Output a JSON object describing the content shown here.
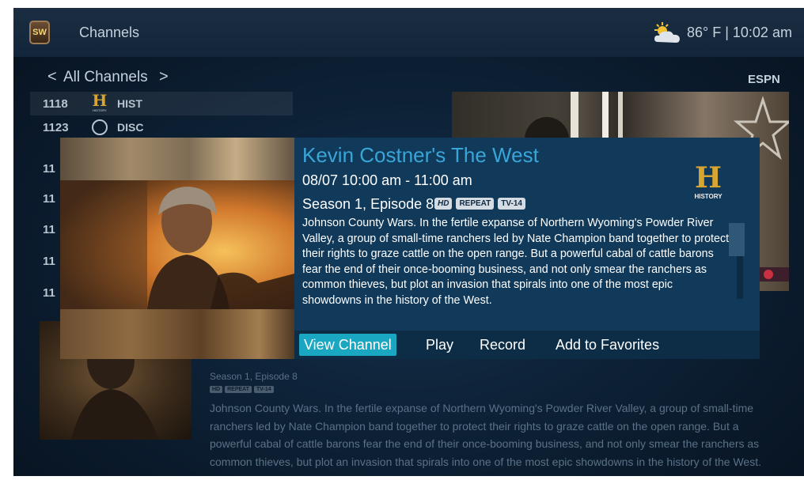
{
  "header": {
    "app_logo_text": "SW",
    "title": "Channels",
    "status": "86° F | 10:02 am"
  },
  "channel_nav": {
    "prev_glyph": "<",
    "label": "All Channels",
    "next_glyph": ">",
    "preview_channel": "ESPN"
  },
  "channels": [
    {
      "number": "1118",
      "name": "HIST",
      "logo": "history-icon",
      "logo_text": "H"
    },
    {
      "number": "1123",
      "name": "DISC",
      "logo": "discovery-icon"
    }
  ],
  "hidden_rows": [
    "11",
    "11",
    "11",
    "11",
    "11"
  ],
  "modal": {
    "title": "Kevin Costner's The West",
    "time": "08/07  10:00 am - 11:00 am",
    "episode": "Season 1, Episode 8",
    "badges": [
      "HD",
      "REPEAT",
      "TV-14"
    ],
    "description": "Johnson County Wars. In the fertile expanse of Northern Wyoming's Powder River Valley, a group of small-time ranchers led by Nate Champion band together to protect their rights to graze cattle on the open range. But a powerful cabal of cattle barons fear the end of their once-booming business, and not only smear the ranchers as common thieves, but plot an invasion that spirals into one of the most epic showdowns in the history of the West.",
    "network_logo": {
      "letter": "H",
      "text": "HISTORY"
    },
    "actions": {
      "view_channel": "View Channel",
      "play": "Play",
      "record": "Record",
      "favorites": "Add to Favorites"
    }
  },
  "details": {
    "episode": "Season 1, Episode 8",
    "badges": [
      "HD",
      "REPEAT",
      "TV-14"
    ],
    "description": "Johnson County Wars. In the fertile expanse of Northern Wyoming's Powder River Valley, a group of small-time ranchers led by Nate Champion band together to protect their rights to graze cattle on the open range. But a powerful cabal of cattle barons fear the end of their once-booming business, and not only smear the ranchers as common thieves, but plot an invasion that spirals into one of the most epic showdowns in the history of the West."
  },
  "colors": {
    "accent": "#1aa7c2",
    "title": "#3aa6d8",
    "modal_background": "#10395a",
    "history_gold": "#d9a531"
  },
  "icons": [
    "app-logo-icon",
    "weather-partly-sunny-icon",
    "history-icon",
    "discovery-icon"
  ]
}
